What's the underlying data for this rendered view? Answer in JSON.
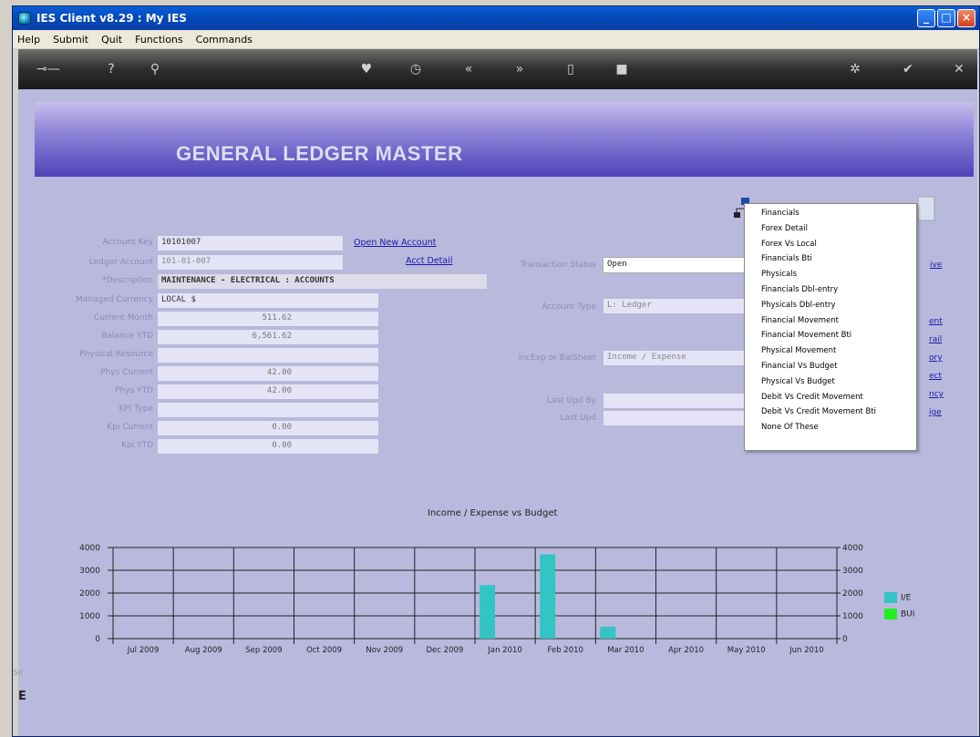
{
  "window": {
    "title": "IES Client v8.29 : My IES"
  },
  "menu": [
    "Help",
    "Submit",
    "Quit",
    "Functions",
    "Commands"
  ],
  "toolbar_icons": [
    "key-icon",
    "help-icon",
    "search-icon",
    "heart-icon",
    "clock-icon",
    "back-icon",
    "forward-icon",
    "page-icon",
    "stop-icon",
    "settings-icon",
    "check-icon",
    "close-icon"
  ],
  "banner": {
    "title": "GENERAL LEDGER MASTER"
  },
  "form": {
    "labels": {
      "account_key": "Account Key",
      "ledger_account": "Ledger Account",
      "description": "*Description",
      "managed_currency": "Managed Currency",
      "current_month": "Current Month",
      "balance_ytd": "Balance YTD",
      "physical_resource": "Physical Resource",
      "phys_current": "Phys Current",
      "phys_ytd": "Phys YTD",
      "kpi_type": "KPI Type",
      "kpi_current": "Kpi Current",
      "kpi_ytd": "Kpi YTD",
      "transaction_status": "Transaction Status",
      "account_type": "Account Type",
      "incexp_balsheet": "IncExp or BalSheet",
      "last_upd_by": "Last Upd By",
      "last_upd": "Last Upd"
    },
    "values": {
      "account_key": "10101007",
      "ledger_account": "101-01-007",
      "description": "MAINTENANCE - ELECTRICAL : ACCOUNTS",
      "managed_currency": "LOCAL $",
      "current_month": "511.62",
      "balance_ytd": "6,561.62",
      "physical_resource": "",
      "phys_current": "42.00",
      "phys_ytd": "42.00",
      "kpi_type": "",
      "kpi_current": "0.00",
      "kpi_ytd": "0.00",
      "transaction_status": "Open",
      "account_type": "L: Ledger",
      "incexp_balsheet": "Income / Expense",
      "last_upd_by": "",
      "last_upd": ""
    },
    "links": {
      "open_new_account": "Open New Account",
      "acct_detail": "Acct Detail"
    }
  },
  "side_links": [
    "ive",
    "ent",
    "rail",
    "ory",
    "ect",
    "ncy",
    "ige"
  ],
  "dropdown": {
    "items": [
      "Financials",
      "Forex Detail",
      "Forex Vs Local",
      "Financials Bti",
      "Physicals",
      "Financials Dbl-entry",
      "Physicals Dbl-entry",
      "Financial Movement",
      "Financial Movement Bti",
      "Physical Movement",
      "Financial Vs Budget",
      "Physical Vs Budget",
      "Debit Vs Credit Movement",
      "Debit Vs Credit Movement Bti",
      "None Of These"
    ]
  },
  "status": {
    "left_text": "Se"
  },
  "chart_data": {
    "type": "bar",
    "title": "Income / Expense vs Budget",
    "categories": [
      "Jul 2009",
      "Aug 2009",
      "Sep 2009",
      "Oct 2009",
      "Nov 2009",
      "Dec 2009",
      "Jan 2010",
      "Feb 2010",
      "Mar 2010",
      "Apr 2010",
      "May 2010",
      "Jun 2010"
    ],
    "series": [
      {
        "name": "I/E",
        "color": "#33c4c4",
        "values": [
          0,
          0,
          0,
          0,
          0,
          0,
          2350,
          3700,
          520,
          0,
          0,
          0
        ]
      },
      {
        "name": "BUI",
        "color": "#22ee22",
        "values": [
          0,
          0,
          0,
          0,
          0,
          0,
          0,
          0,
          0,
          0,
          0,
          0
        ]
      }
    ],
    "yticks": [
      "0",
      "1000",
      "2000",
      "3000",
      "4000"
    ],
    "ylim": [
      0,
      4000
    ],
    "grid": true,
    "legend": "right"
  }
}
